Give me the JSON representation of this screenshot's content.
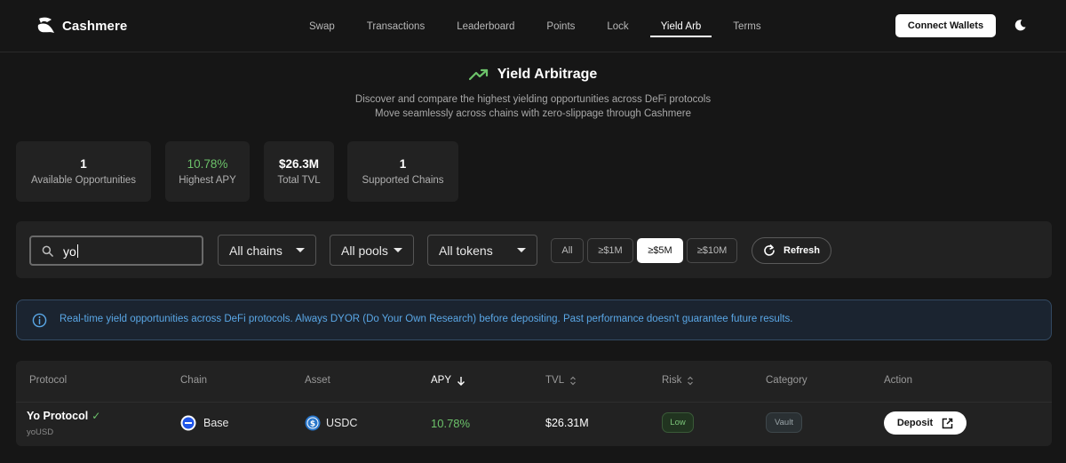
{
  "header": {
    "brand": "Cashmere",
    "nav": [
      {
        "label": "Swap",
        "active": false
      },
      {
        "label": "Transactions",
        "active": false
      },
      {
        "label": "Leaderboard",
        "active": false
      },
      {
        "label": "Points",
        "active": false
      },
      {
        "label": "Lock",
        "active": false
      },
      {
        "label": "Yield Arb",
        "active": true
      },
      {
        "label": "Terms",
        "active": false
      }
    ],
    "connect_label": "Connect Wallets",
    "theme_icon": "moon-icon"
  },
  "hero": {
    "title": "Yield Arbitrage",
    "subtitle_1": "Discover and compare the highest yielding opportunities across DeFi protocols",
    "subtitle_2": "Move seamlessly across chains with zero-slippage through Cashmere",
    "icon": "trending-up-icon"
  },
  "stats": [
    {
      "value": "1",
      "label": "Available Opportunities"
    },
    {
      "value": "10.78%",
      "label": "Highest APY"
    },
    {
      "value": "$26.3M",
      "label": "Total TVL"
    },
    {
      "value": "1",
      "label": "Supported Chains"
    }
  ],
  "filters": {
    "search_value": "yo",
    "chains": "All chains",
    "pools": "All pools",
    "tokens": "All tokens",
    "tvl_options": [
      {
        "label": "All",
        "active": false
      },
      {
        "label": "≥$1M",
        "active": false
      },
      {
        "label": "≥$5M",
        "active": true
      },
      {
        "label": "≥$10M",
        "active": false
      }
    ],
    "refresh_label": "Refresh"
  },
  "info_banner": "Real-time yield opportunities across DeFi protocols. Always DYOR (Do Your Own Research) before depositing. Past performance doesn't guarantee future results.",
  "table": {
    "columns": [
      "Protocol",
      "Chain",
      "Asset",
      "APY",
      "TVL",
      "Risk",
      "Category",
      "Action"
    ],
    "sort_column": "APY",
    "rows": [
      {
        "protocol": "Yo Protocol",
        "verified": "✓",
        "pool": "yoUSD",
        "chain": "Base",
        "asset": "USDC",
        "apy": "10.78%",
        "tvl": "$26.31M",
        "risk": "Low",
        "category": "Vault",
        "action": "Deposit"
      }
    ]
  },
  "colors": {
    "background": "#161616",
    "card": "#222222",
    "positive": "#6cc26a",
    "info": "#5aa7e6"
  }
}
